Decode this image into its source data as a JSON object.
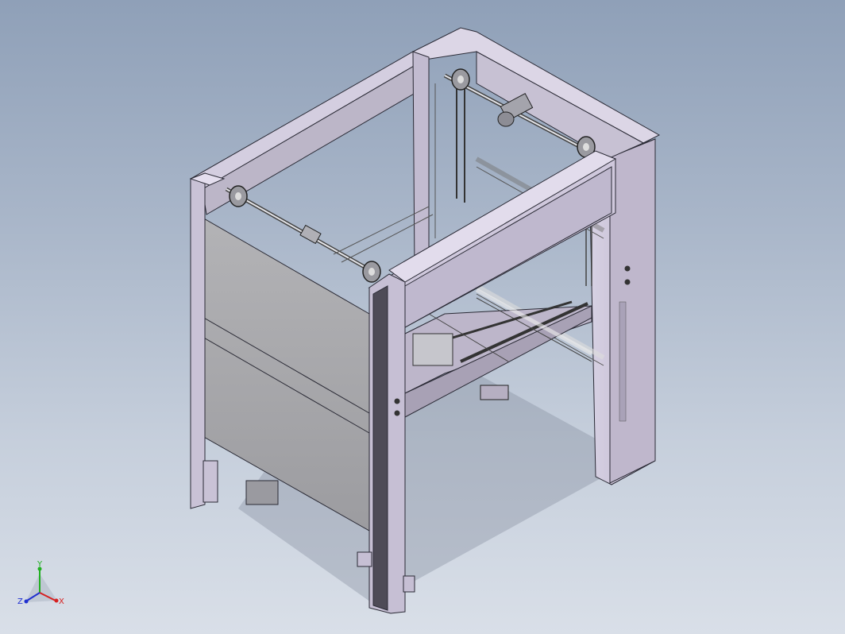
{
  "viewport": {
    "background_top": "#8fa0b8",
    "background_bottom": "#d9dfe8"
  },
  "model": {
    "frame_color": "#c9c2d6",
    "panel_color": "#a8a8ab",
    "edge_color": "#2a2a35"
  },
  "triad": {
    "x_label": "X",
    "y_label": "Y",
    "z_label": "Z",
    "x_color": "#d62020",
    "y_color": "#20b020",
    "z_color": "#2030d0"
  }
}
